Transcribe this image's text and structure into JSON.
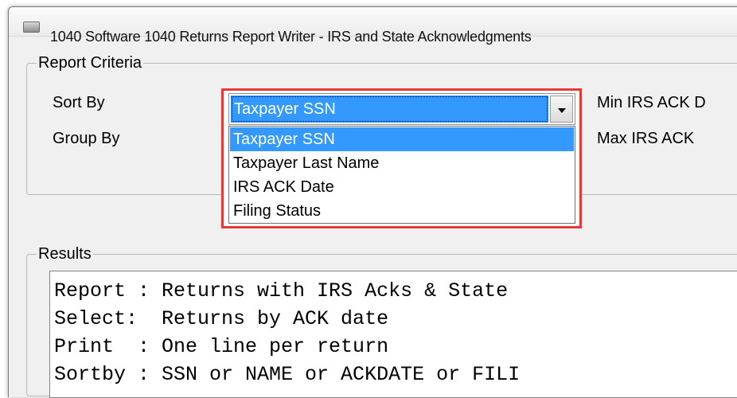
{
  "window": {
    "title": "1040 Software 1040 Returns Report Writer - IRS and State Acknowledgments"
  },
  "criteria": {
    "legend": "Report Criteria",
    "sort_by_label": "Sort By",
    "group_by_label": "Group By",
    "min_label": "Min IRS ACK D",
    "max_label": "Max IRS ACK",
    "sort_combo": {
      "value": "Taxpayer SSN",
      "options": [
        "Taxpayer SSN",
        "Taxpayer Last Name",
        "IRS ACK Date",
        "Filing Status"
      ],
      "selected_index": 0
    }
  },
  "results": {
    "legend": "Results",
    "lines": [
      "Report : Returns with IRS Acks & State",
      "Select:  Returns by ACK date",
      "Print  : One line per return",
      "Sortby : SSN or NAME or ACKDATE or FILI"
    ]
  },
  "colors": {
    "highlight": "#3399ff",
    "callout_border": "#e43a3a"
  }
}
